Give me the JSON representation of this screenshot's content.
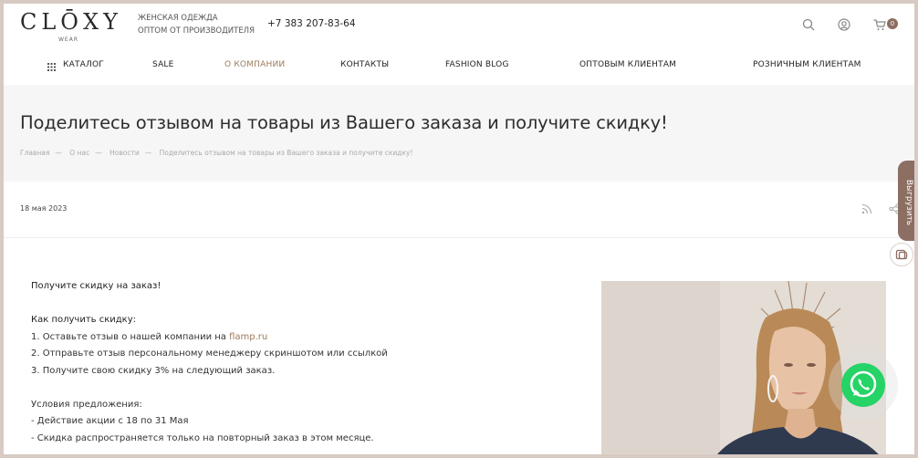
{
  "header": {
    "logo": "CLŌXY",
    "logo_sub": "WEAR",
    "tagline_line1": "ЖЕНСКАЯ ОДЕЖДА",
    "tagline_line2": "ОПТОМ ОТ ПРОИЗВОДИТЕЛЯ",
    "phone": "+7 383 207-83-64",
    "cart_count": "0",
    "icons": [
      "search-icon",
      "user-icon",
      "cart-icon"
    ]
  },
  "nav": {
    "items": [
      {
        "label": "КАТАЛОГ"
      },
      {
        "label": "SALE"
      },
      {
        "label": "О КОМПАНИИ"
      },
      {
        "label": "КОНТАКТЫ"
      },
      {
        "label": "FASHION BLOG"
      },
      {
        "label": "ОПТОВЫМ КЛИЕНТАМ"
      },
      {
        "label": "РОЗНИЧНЫМ КЛИЕНТАМ"
      }
    ],
    "active": "О КОМПАНИИ"
  },
  "page": {
    "title": "Поделитесь отзывом на товары из Вашего заказа и получите скидку!",
    "breadcrumb": [
      "Главная",
      "О нас",
      "Новости",
      "Поделитесь отзывом на товары из Вашего заказа и получите скидку!"
    ],
    "breadcrumb_sep": "—",
    "date": "18 мая 2023"
  },
  "article": {
    "heading": "Получите скидку на заказ!",
    "how_title": "Как получить скидку:",
    "step1_prefix": "1. Оставьте отзыв о нашей компании на ",
    "step1_link": "flamp.ru",
    "step2": "2. Отправьте отзыв персональному менеджеру скриншотом или ссылкой",
    "step3": "3. Получите свою скидку 3% на следующий заказ.",
    "conditions_title": "Условия предложения:",
    "cond1": "- Действие акции с 18 по 31 Мая",
    "cond2": "- Скидка распространяется только на повторный заказ в этом месяце."
  },
  "side": {
    "tab_label": "Выгрузить"
  },
  "colors": {
    "accent": "#9c7a5b",
    "side_tab": "#8d6e63",
    "whatsapp": "#25d366",
    "title_band": "#f7f6f6"
  }
}
